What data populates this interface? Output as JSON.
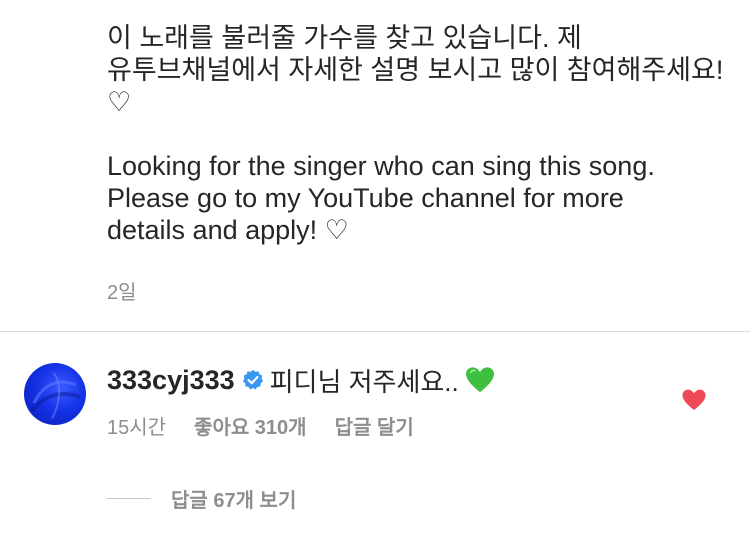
{
  "caption": {
    "line_ko_1": "이 노래를 불러줄 가수를 찾고 있습니다. 제",
    "line_ko_2": "유투브채널에서 자세한 설명 보시고 많이 참여해주세요!",
    "line_ko_3": "♡",
    "line_en_1": "Looking for the singer who can sing this song.",
    "line_en_2": "Please go to my YouTube channel for more",
    "line_en_3": "details and apply! ♡",
    "time": "2일"
  },
  "comment": {
    "username": "333cyj333",
    "text": "피디님 저주세요..",
    "avatar_color": "#1432e6",
    "verified_color": "#3897f0",
    "emoji": "green-heart-icon",
    "emoji_color": "#3fbf3f",
    "time": "15시간",
    "likes": "좋아요 310개",
    "reply_label": "답글 달기",
    "like_icon_color": "#ed4956"
  },
  "replies": {
    "view_label": "답글 67개 보기"
  }
}
